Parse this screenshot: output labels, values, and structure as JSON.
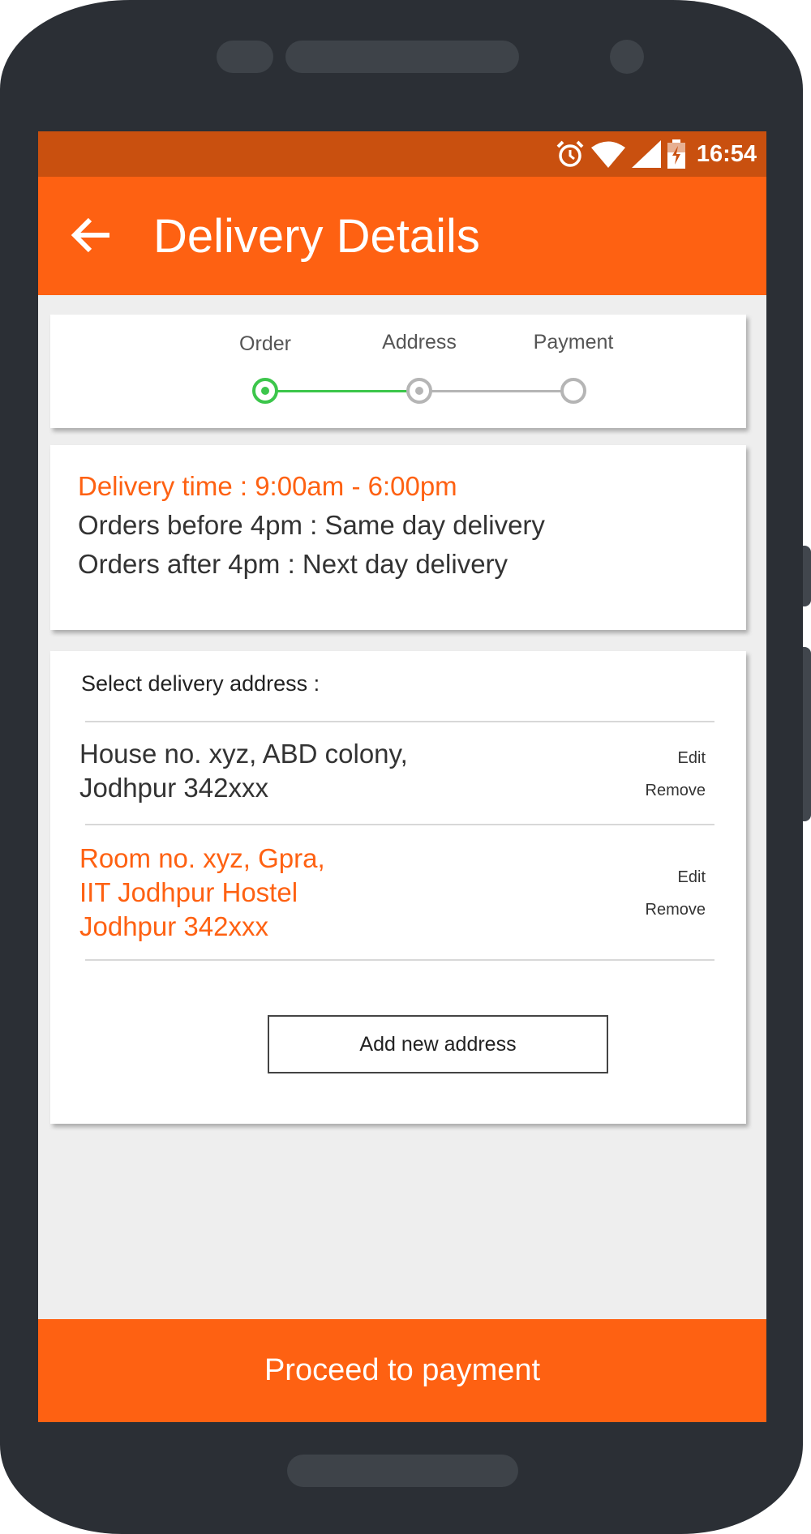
{
  "status_bar": {
    "time": "16:54",
    "icons": [
      "alarm-icon",
      "wifi-icon",
      "cell-signal-icon",
      "battery-charging-icon"
    ]
  },
  "app_bar": {
    "title": "Delivery Details",
    "back_icon": "arrow-back-icon"
  },
  "steps": [
    {
      "label": "Order",
      "state": "active"
    },
    {
      "label": "Address",
      "state": "reached"
    },
    {
      "label": "Payment",
      "state": "pending"
    }
  ],
  "delivery_info": {
    "time": "Delivery time : 9:00am - 6:00pm",
    "before": "Orders before 4pm : Same day delivery",
    "after": "Orders after 4pm : Next day delivery"
  },
  "address_section": {
    "header": "Select delivery address :",
    "addresses": [
      {
        "text": "House no. xyz, ABD colony,\nJodhpur 342xxx",
        "selected": false,
        "edit": "Edit",
        "remove": "Remove"
      },
      {
        "text": "Room no. xyz, Gpra,\nIIT Jodhpur Hostel\nJodhpur 342xxx",
        "selected": true,
        "edit": "Edit",
        "remove": "Remove"
      }
    ],
    "add_button": "Add new address"
  },
  "proceed_button": "Proceed to payment",
  "colors": {
    "accent": "#fe6112",
    "status_bar": "#c9500f",
    "step_active": "#3cc64b",
    "step_inactive": "#b5b5b5",
    "selected_text": "#fe6112",
    "body_text": "#333333"
  }
}
